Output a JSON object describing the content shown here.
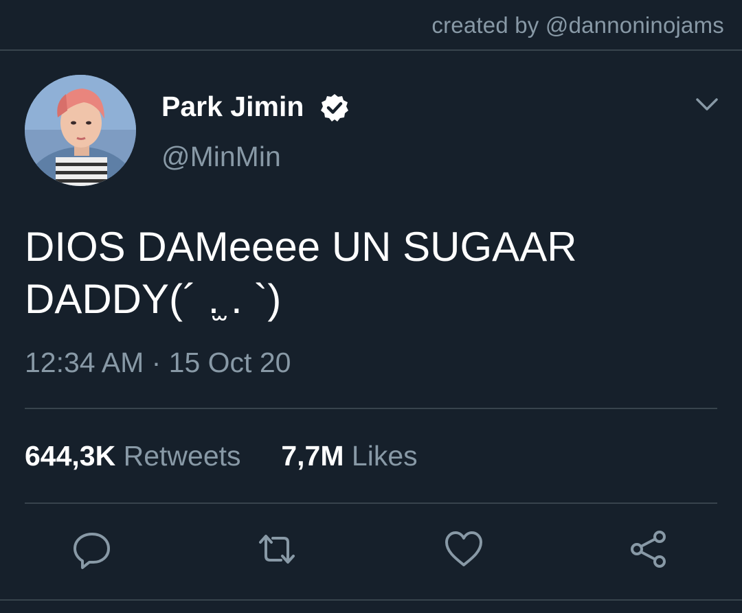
{
  "credit": "created by @dannoninojams",
  "user": {
    "display_name": "Park Jimin",
    "handle": "@MinMin",
    "verified": true,
    "avatar_icon": "profile-photo"
  },
  "tweet": {
    "text": "DIOS DAMeeee UN SUGAAR\nDADDY(´ .̫ . `)",
    "timestamp": "12:34 AM · 15 Oct 20"
  },
  "stats": {
    "retweets_count": "644,3K",
    "retweets_label": "Retweets",
    "likes_count": "7,7M",
    "likes_label": "Likes"
  },
  "actions": {
    "reply_icon": "reply-icon",
    "retweet_icon": "retweet-icon",
    "like_icon": "heart-icon",
    "share_icon": "share-icon"
  },
  "colors": {
    "background": "#16202b",
    "secondary_text": "#8899a6",
    "divider": "#38444d",
    "text": "#ffffff"
  }
}
